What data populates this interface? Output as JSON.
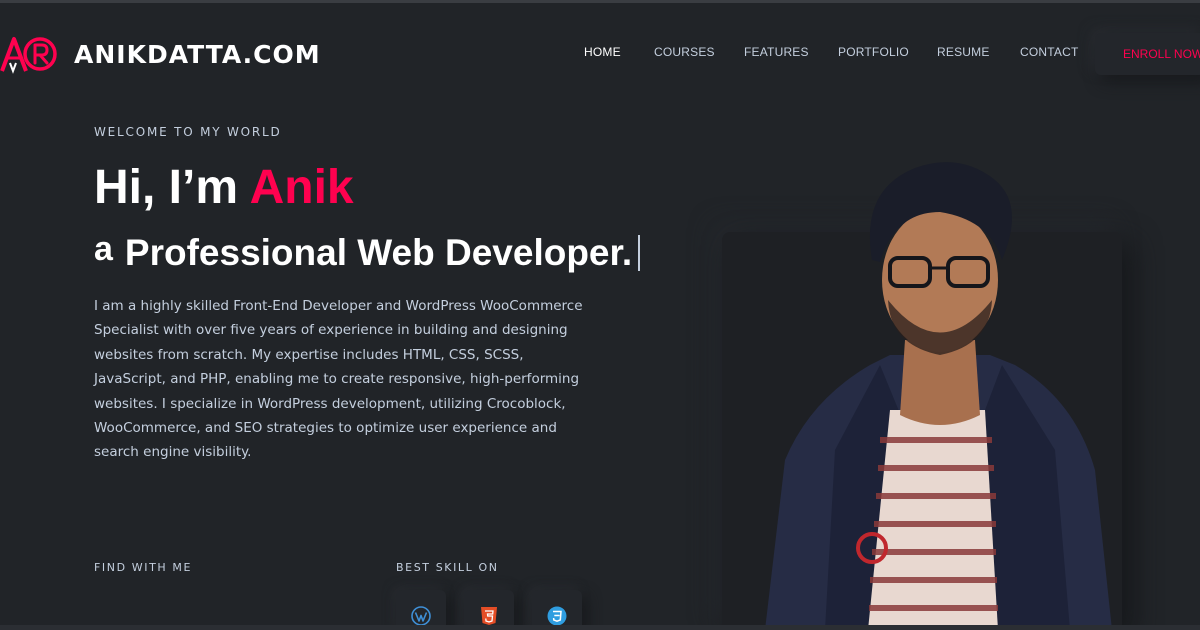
{
  "header": {
    "brand": "ANIKDATTA.COM",
    "nav": [
      {
        "label": "HOME",
        "active": true
      },
      {
        "label": "COURSES",
        "active": false
      },
      {
        "label": "FEATURES",
        "active": false
      },
      {
        "label": "PORTFOLIO",
        "active": false
      },
      {
        "label": "RESUME",
        "active": false
      },
      {
        "label": "CONTACT",
        "active": false
      }
    ],
    "cta": "ENROLL NOW"
  },
  "hero": {
    "eyebrow": "WELCOME TO MY WORLD",
    "greeting": "Hi, I’m ",
    "name": "Anik",
    "role_prefix": "a",
    "role": "Professional Web Developer.",
    "description": "I am a highly skilled Front-End Developer and WordPress WooCommerce Specialist with over five years of experience in building and designing websites from scratch. My expertise includes HTML, CSS, SCSS, JavaScript, and PHP, enabling me to create responsive, high-performing websites. I specialize in WordPress development, utilizing Crocoblock, WooCommerce, and SEO strategies to optimize user experience and search engine visibility.",
    "find_label": "FIND WITH ME",
    "skills_label": "BEST SKILL ON",
    "skills": [
      {
        "icon": "wordpress-icon"
      },
      {
        "icon": "html5-icon"
      },
      {
        "icon": "css3-icon"
      }
    ]
  },
  "colors": {
    "background": "#212428",
    "accent": "#ff014f",
    "text": "#c4cfde",
    "heading": "#ffffff"
  }
}
